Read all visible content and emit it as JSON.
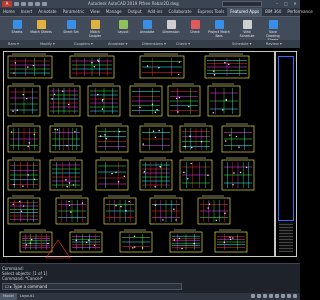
{
  "window": {
    "app_menu": "A",
    "title": "Autodesk AutoCAD 2019   Ptfree   Rebar2D.dwg",
    "controls": [
      "–",
      "□",
      "✕"
    ]
  },
  "ribbon_tabs": [
    "Home",
    "Insert",
    "Annotate",
    "Parametric",
    "View",
    "Manage",
    "Output",
    "Add-ins",
    "Collaborate",
    "Express Tools",
    "Featured Apps",
    "BIM 360",
    "Performance"
  ],
  "ribbon_tabs_active": 10,
  "ribbon_buttons": [
    {
      "label": "Sheets",
      "color": "#3a8ee6"
    },
    {
      "label": "Match Sheets",
      "color": "#e0b040"
    },
    {
      "label": "Sheet Set",
      "color": "#3a8ee6"
    },
    {
      "label": "Match Coupler",
      "color": "#e0b040"
    },
    {
      "label": "Layout",
      "color": "#8fbf5f"
    },
    {
      "label": "Annotate",
      "color": "#3a8ee6"
    },
    {
      "label": "Dimension",
      "color": "#cfcfcf"
    },
    {
      "label": "Check",
      "color": "#e05a5a"
    },
    {
      "label": "Project Match Bars",
      "color": "#3a8ee6"
    },
    {
      "label": "View Schedule",
      "color": "#cfcfcf"
    },
    {
      "label": "Save Drawing Sheets",
      "color": "#3a8ee6"
    }
  ],
  "ribbon_panels": [
    "Bars ▾",
    "Modify ▾",
    "Couplers ▾",
    "Annotate ▾",
    "Dimensions ▾",
    "Check ▾",
    "Schedule ▾",
    "Review ▾"
  ],
  "command_history": [
    "Command:",
    "Select objects: [1 of 1]",
    "Command: *Cancel*"
  ],
  "command_prompt": "☐ ▸ Type a command",
  "layout_tabs": [
    "Model",
    "Layout1"
  ],
  "layout_tabs_active": 0,
  "colors": {
    "detail_border": "#ffff40",
    "rebar_red": "#ff3030",
    "rebar_magenta": "#ff40ff",
    "rebar_green": "#40ff40",
    "rebar_cyan": "#40ffff",
    "text_white": "#ffffff",
    "title_block_blue": "#2f6fff"
  }
}
